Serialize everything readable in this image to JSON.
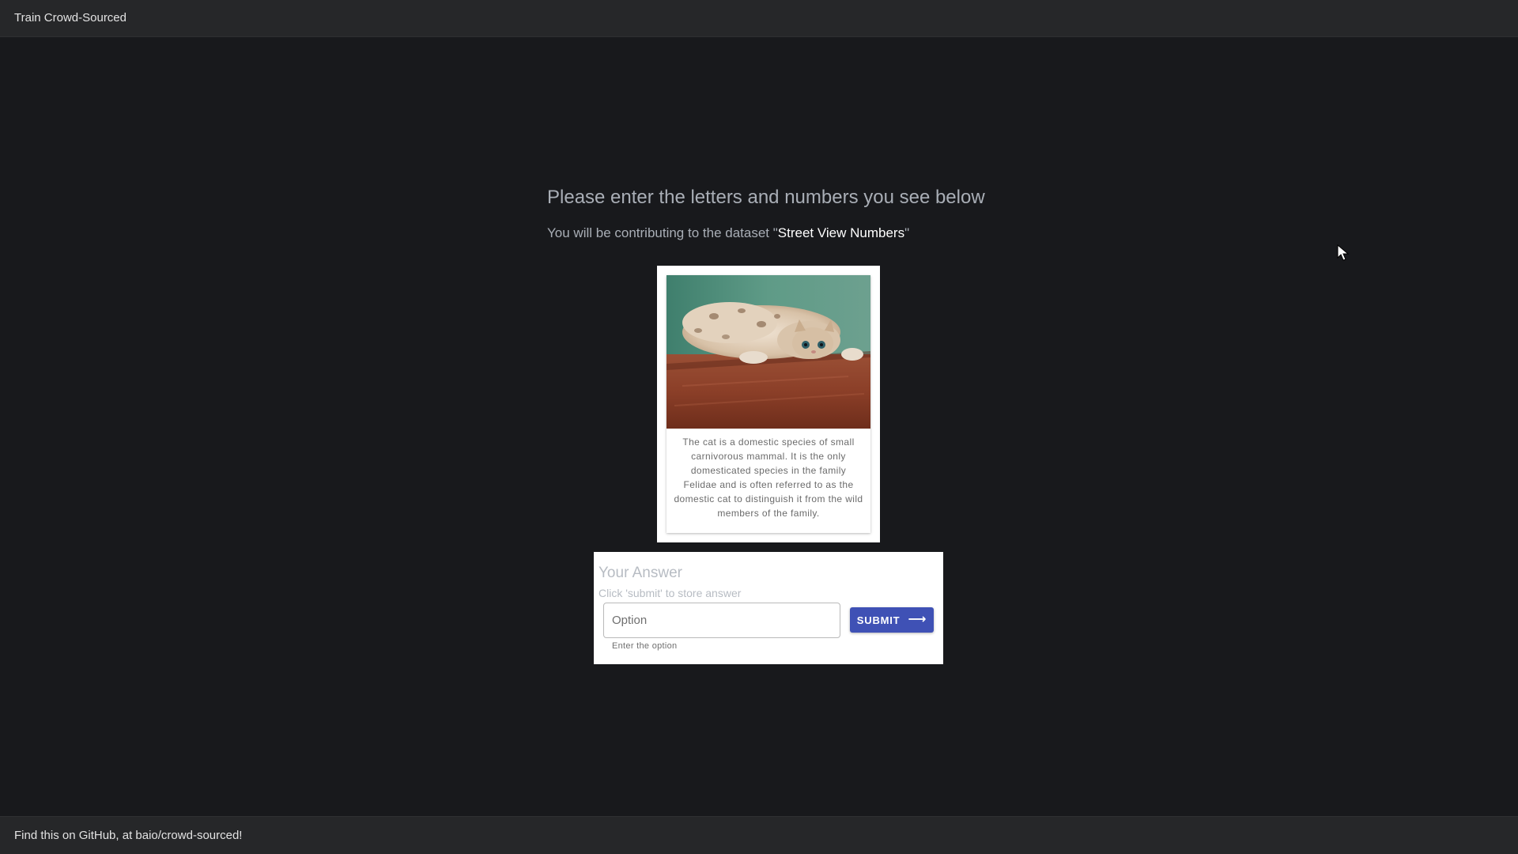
{
  "header": {
    "title": "Train Crowd-Sourced"
  },
  "main": {
    "heading": "Please enter the letters and numbers you see below",
    "subheading_prefix": "You will be contributing to the dataset \"",
    "dataset_name": "Street View Numbers",
    "subheading_suffix": "\"",
    "image_card": {
      "image_icon": "cat-photo",
      "caption": "The cat is a domestic species of small carnivorous mammal. It is the only domesticated species in the family Felidae and is often referred to as the domestic cat to distinguish it from the wild members of the family."
    },
    "answer_card": {
      "title": "Your Answer",
      "subtitle": "Click 'submit' to store answer",
      "input_placeholder": "Option",
      "input_value": "",
      "helper_text": "Enter the option",
      "submit_label": "SUBMIT",
      "submit_icon": "arrow-right-icon",
      "button_color": "#3f51b5"
    }
  },
  "footer": {
    "text": "Find this on GitHub, at baio/crowd-sourced!"
  },
  "colors": {
    "background": "#18191c",
    "header_bg": "#262729",
    "accent": "#3f51b5"
  }
}
